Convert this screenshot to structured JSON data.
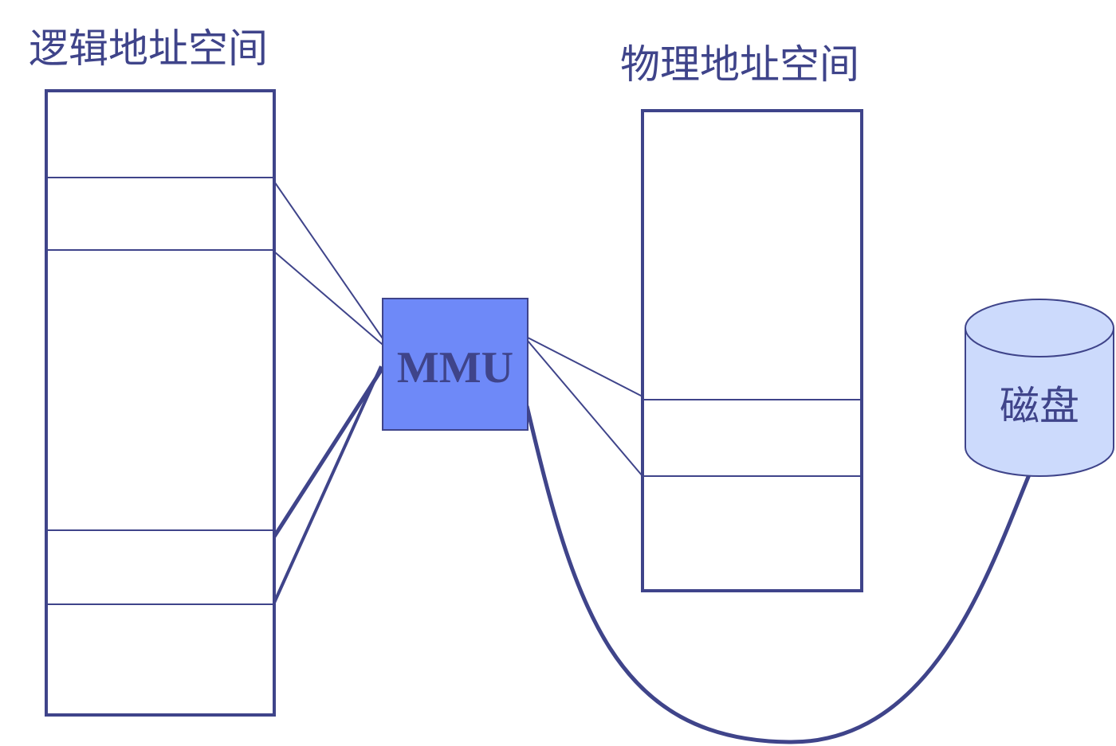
{
  "logical_title": "逻辑地址空间",
  "physical_title": "物理地址空间",
  "mmu_label": "MMU",
  "disk_label": "磁盘",
  "colors": {
    "stroke": "#3f448a",
    "mmu_fill": "#6e89f8",
    "disk_fill": "#ccdafc"
  }
}
